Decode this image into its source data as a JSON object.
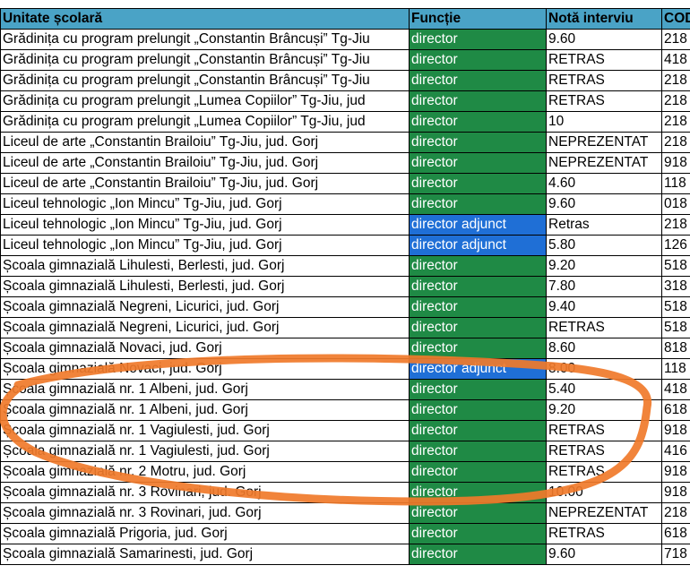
{
  "headers": [
    "Unitate școlară",
    "Funcție",
    "Notă interviu",
    "COD"
  ],
  "colors": {
    "header": "#4aa3c6",
    "director": "#1f8a45",
    "director_adjunct": "#1f6fd6",
    "annotation": "#f07a2a"
  },
  "rows": [
    {
      "unit": "Grădinița cu program prelungit „Constantin Brâncuși” Tg-Jiu",
      "role": "director",
      "score": "9.60",
      "code": "218"
    },
    {
      "unit": "Grădinița cu program prelungit „Constantin Brâncuși” Tg-Jiu",
      "role": "director",
      "score": "RETRAS",
      "code": "418"
    },
    {
      "unit": "Grădinița cu program prelungit „Constantin Brâncuși” Tg-Jiu",
      "role": "director",
      "score": "RETRAS",
      "code": "218"
    },
    {
      "unit": "Grădinița cu program prelungit „Lumea Copiilor” Tg-Jiu, jud",
      "role": "director",
      "score": "RETRAS",
      "code": "218"
    },
    {
      "unit": "Grădinița cu program prelungit „Lumea Copiilor” Tg-Jiu, jud",
      "role": "director",
      "score": "10",
      "code": "218"
    },
    {
      "unit": "Liceul de arte „Constantin Brailoiu” Tg-Jiu, jud. Gorj",
      "role": "director",
      "score": "NEPREZENTAT",
      "code": "218"
    },
    {
      "unit": "Liceul de arte „Constantin Brailoiu” Tg-Jiu, jud. Gorj",
      "role": "director",
      "score": "NEPREZENTAT",
      "code": "918"
    },
    {
      "unit": "Liceul de arte „Constantin Brailoiu” Tg-Jiu, jud. Gorj",
      "role": "director",
      "score": "4.60",
      "code": "118"
    },
    {
      "unit": "Liceul tehnologic „Ion Mincu” Tg-Jiu, jud. Gorj",
      "role": "director",
      "score": "9.60",
      "code": "018"
    },
    {
      "unit": "Liceul tehnologic „Ion Mincu” Tg-Jiu, jud. Gorj",
      "role": "director adjunct",
      "score": "Retras",
      "code": "218"
    },
    {
      "unit": "Liceul tehnologic „Ion Mincu” Tg-Jiu, jud. Gorj",
      "role": "director adjunct",
      "score": "5.80",
      "code": "126"
    },
    {
      "unit": "Școala gimnazială Lihulesti, Berlesti, jud. Gorj",
      "role": "director",
      "score": "9.20",
      "code": "518"
    },
    {
      "unit": "Școala gimnazială Lihulesti, Berlesti, jud. Gorj",
      "role": "director",
      "score": "7.80",
      "code": "318"
    },
    {
      "unit": "Școala gimnazială Negreni, Licurici, jud. Gorj",
      "role": "director",
      "score": "9.40",
      "code": "518"
    },
    {
      "unit": "Școala gimnazială Negreni, Licurici, jud. Gorj",
      "role": "director",
      "score": "RETRAS",
      "code": "518"
    },
    {
      "unit": "Școala gimnazială Novaci, jud. Gorj",
      "role": "director",
      "score": "8.60",
      "code": "818"
    },
    {
      "unit": "Școala gimnazială Novaci, jud. Gorj",
      "role": "director adjunct",
      "score": "8.00",
      "code": "118"
    },
    {
      "unit": "Școala gimnazială nr. 1 Albeni, jud. Gorj",
      "role": "director",
      "score": "5.40",
      "code": "418"
    },
    {
      "unit": "Școala gimnazială nr. 1 Albeni, jud. Gorj",
      "role": "director",
      "score": "9.20",
      "code": "618"
    },
    {
      "unit": "Școala gimnazială nr. 1 Vagiulesti, jud. Gorj",
      "role": "director",
      "score": "RETRAS",
      "code": "918"
    },
    {
      "unit": "Școala gimnazială nr. 1 Vagiulesti, jud. Gorj",
      "role": "director",
      "score": "RETRAS",
      "code": "416"
    },
    {
      "unit": "Școala gimnazială nr. 2 Motru, jud. Gorj",
      "role": "director",
      "score": "RETRAS",
      "code": "918"
    },
    {
      "unit": "Școala gimnazială nr. 3 Rovinari, jud. Gorj",
      "role": "director",
      "score": "10.00",
      "code": "918"
    },
    {
      "unit": "Școala gimnazială nr. 3 Rovinari, jud. Gorj",
      "role": "director",
      "score": "NEPREZENTAT",
      "code": "218"
    },
    {
      "unit": "Școala gimnazială Prigoria, jud. Gorj",
      "role": "director",
      "score": "RETRAS",
      "code": "618"
    },
    {
      "unit": "Școala gimnazială Samarinesti, jud. Gorj",
      "role": "director",
      "score": "9.60",
      "code": "718"
    }
  ]
}
